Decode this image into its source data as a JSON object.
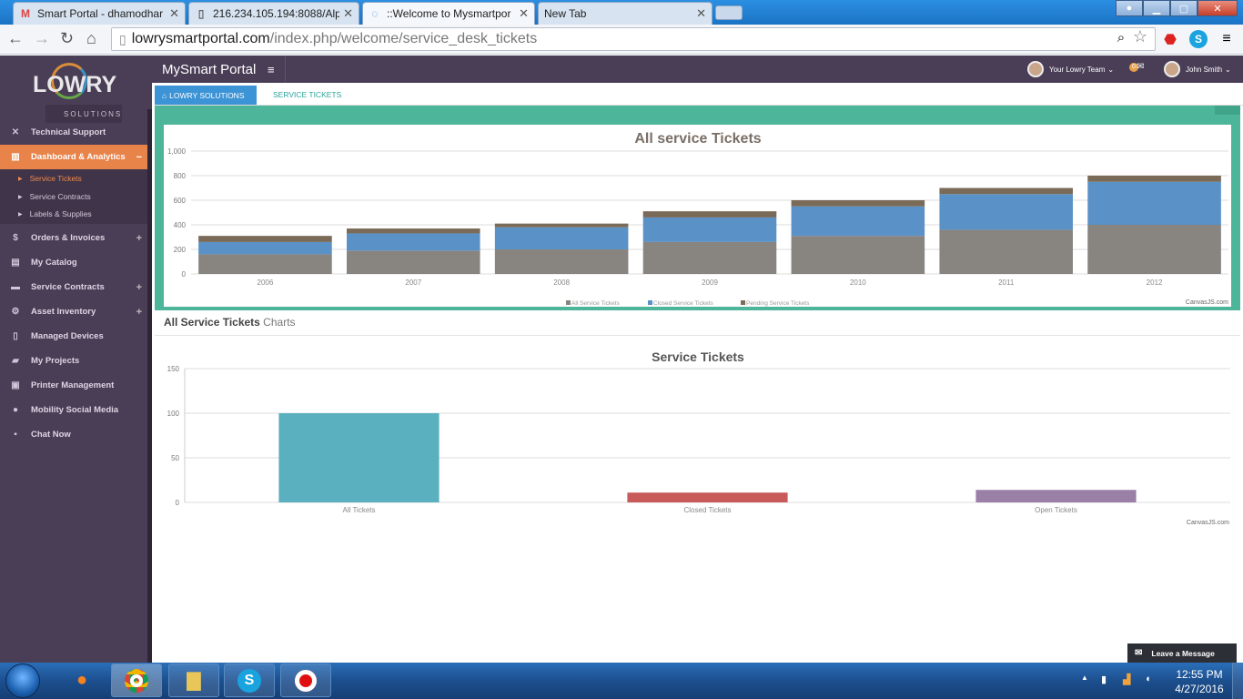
{
  "browser": {
    "tabs": [
      {
        "title": "Smart Portal - dhamodhar",
        "icon": "gmail-icon"
      },
      {
        "title": "216.234.105.194:8088/Alp",
        "icon": "page-icon"
      },
      {
        "title": "::Welcome to Mysmartpor",
        "icon": "loading-icon"
      },
      {
        "title": "New Tab",
        "icon": ""
      }
    ],
    "url_host": "lowrysmartportal.com",
    "url_path": "/index.php/welcome/service_desk_tickets"
  },
  "sidebar": {
    "logo": "LOWRY",
    "logo_sub": "SOLUTIONS",
    "items": [
      {
        "label": "Technical Support",
        "icon": "wrench-icon"
      },
      {
        "label": "Dashboard & Analytics",
        "icon": "chart-icon"
      },
      {
        "label": "Orders & Invoices",
        "icon": "dollar-icon"
      },
      {
        "label": "My Catalog",
        "icon": "book-icon"
      },
      {
        "label": "Service Contracts",
        "icon": "truck-icon"
      },
      {
        "label": "Asset Inventory",
        "icon": "gear-icon"
      },
      {
        "label": "Managed Devices",
        "icon": "phone-icon"
      },
      {
        "label": "My Projects",
        "icon": "folder-icon"
      },
      {
        "label": "Printer Management",
        "icon": "printer-icon"
      },
      {
        "label": "Mobility Social Media",
        "icon": "users-icon"
      },
      {
        "label": "Chat Now",
        "icon": "chat-icon"
      }
    ],
    "subitems": [
      "Service Tickets",
      "Service Contracts",
      "Labels & Supplies"
    ],
    "collapse": "−",
    "expand": "+"
  },
  "header": {
    "brand": "MySmart Portal",
    "team": "Your Lowry Team",
    "notif_count": "0",
    "user": "John Smith"
  },
  "breadcrumb": {
    "home": "LOWRY SOLUTIONS",
    "current": "SERVICE TICKETS"
  },
  "section": {
    "title_bold": "All Service Tickets",
    "title_light": " Charts"
  },
  "credit": "CanvasJS.com",
  "leave_message": "Leave a Message",
  "clock": {
    "time": "12:55 PM",
    "date": "4/27/2016"
  },
  "chart_data": [
    {
      "type": "bar",
      "stacked": true,
      "title": "All service Tickets",
      "categories": [
        "2006",
        "2007",
        "2008",
        "2009",
        "2010",
        "2011",
        "2012"
      ],
      "series": [
        {
          "name": "All Service Tickets",
          "color": "#888480",
          "values": [
            160,
            190,
            200,
            260,
            310,
            360,
            400
          ]
        },
        {
          "name": "Closed Service Tickets",
          "color": "#5a91c7",
          "values": [
            100,
            140,
            180,
            200,
            240,
            290,
            350
          ]
        },
        {
          "name": "Pending Service Tickets",
          "color": "#7a6a58",
          "values": [
            50,
            40,
            30,
            50,
            50,
            50,
            50
          ]
        }
      ],
      "yticks": [
        "0",
        "200",
        "400",
        "600",
        "800",
        "1,000"
      ],
      "ylim": [
        0,
        1000
      ],
      "grid": true,
      "legend": "bottom"
    },
    {
      "type": "bar",
      "title": "Service Tickets",
      "categories": [
        "All Tickets",
        "Closed Tickets",
        "Open Tickets"
      ],
      "values": [
        100,
        11,
        14
      ],
      "colors": [
        "#5ab0bf",
        "#c85a5a",
        "#9a7fa6"
      ],
      "yticks": [
        "0",
        "50",
        "100",
        "150"
      ],
      "ylim": [
        0,
        150
      ],
      "grid": true
    }
  ]
}
